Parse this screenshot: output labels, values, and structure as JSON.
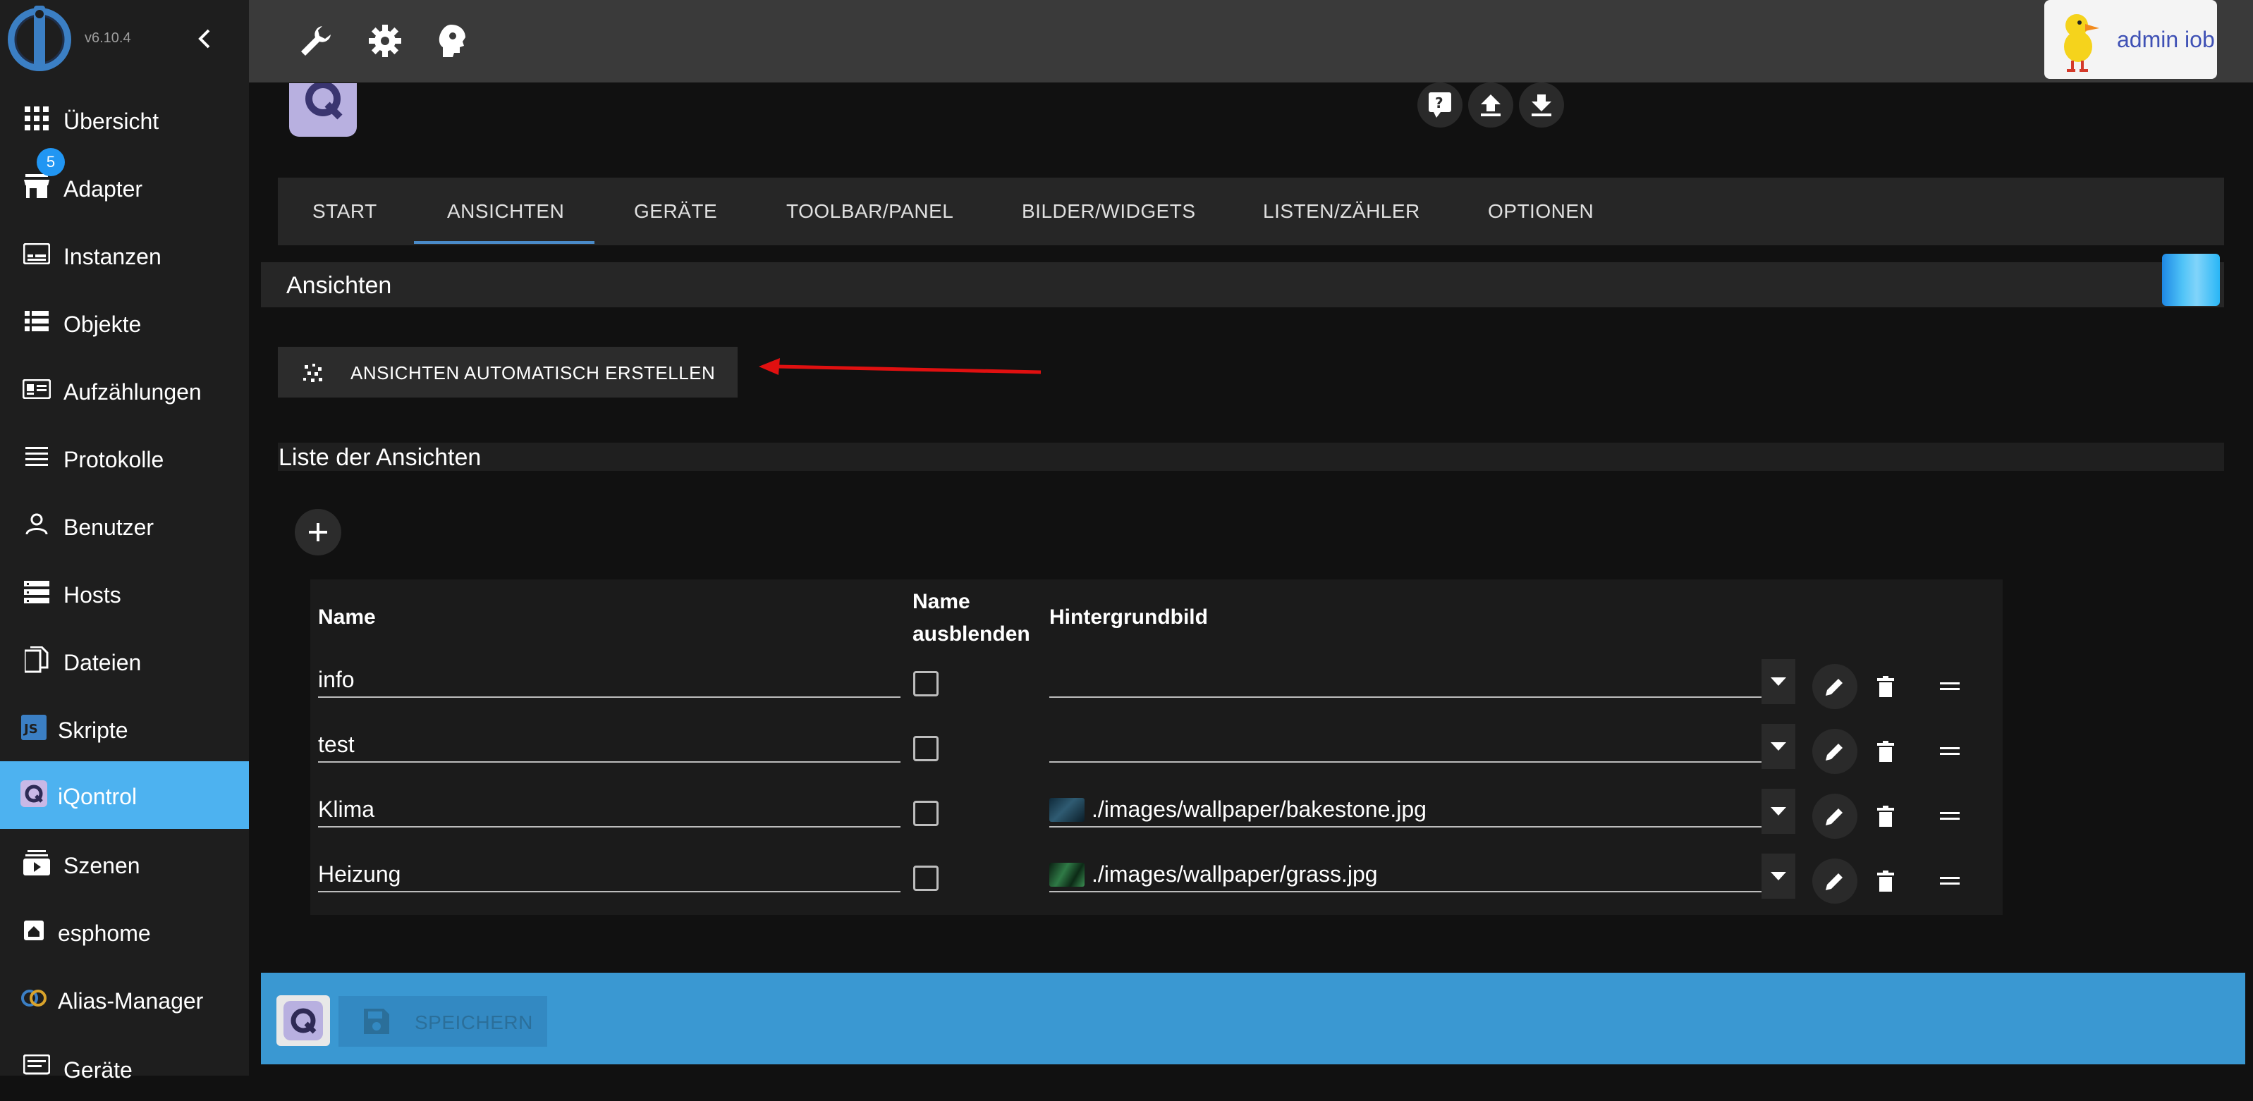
{
  "app": {
    "version": "v6.10.4"
  },
  "sidebar": {
    "items": [
      {
        "label": "Übersicht",
        "icon": "grid-icon"
      },
      {
        "label": "Adapter",
        "icon": "store-icon",
        "badge": "5"
      },
      {
        "label": "Instanzen",
        "icon": "instances-icon"
      },
      {
        "label": "Objekte",
        "icon": "list-icon"
      },
      {
        "label": "Aufzählungen",
        "icon": "enum-icon"
      },
      {
        "label": "Protokolle",
        "icon": "log-icon"
      },
      {
        "label": "Benutzer",
        "icon": "user-icon"
      },
      {
        "label": "Hosts",
        "icon": "server-icon"
      },
      {
        "label": "Dateien",
        "icon": "files-icon"
      },
      {
        "label": "Skripte",
        "icon": "javascript-icon"
      },
      {
        "label": "iQontrol",
        "icon": "iqontrol-icon",
        "active": true
      },
      {
        "label": "Szenen",
        "icon": "scenes-icon"
      },
      {
        "label": "esphome",
        "icon": "esphome-icon"
      },
      {
        "label": "Alias-Manager",
        "icon": "alias-icon"
      },
      {
        "label": "Geräte",
        "icon": "devices-icon"
      }
    ]
  },
  "topbar": {
    "tools": [
      "wrench-icon",
      "gear-icon",
      "expert-head-icon"
    ],
    "user": "admin iob"
  },
  "tabs": {
    "items": [
      "START",
      "ANSICHTEN",
      "GERÄTE",
      "TOOLBAR/PANEL",
      "BILDER/WIDGETS",
      "LISTEN/ZÄHLER",
      "OPTIONEN"
    ],
    "active": "ANSICHTEN"
  },
  "section": {
    "title": "Ansichten"
  },
  "auto_button": {
    "label": "ANSICHTEN AUTOMATISCH ERSTELLEN"
  },
  "list": {
    "title": "Liste der Ansichten",
    "columns": {
      "name": "Name",
      "hide_name_1": "Name",
      "hide_name_2": "ausblenden",
      "background": "Hintergrundbild"
    },
    "rows": [
      {
        "name": "info",
        "background": ""
      },
      {
        "name": "test",
        "background": ""
      },
      {
        "name": "Klima",
        "background": "./images/wallpaper/bakestone.jpg"
      },
      {
        "name": "Heizung",
        "background": "./images/wallpaper/grass.jpg"
      }
    ]
  },
  "footer": {
    "save_label": "SPEICHERN"
  },
  "colors": {
    "accent": "#4db2f0",
    "footer": "#3a98d2",
    "annotation_arrow": "#e01010",
    "badge": "#2196f3"
  }
}
